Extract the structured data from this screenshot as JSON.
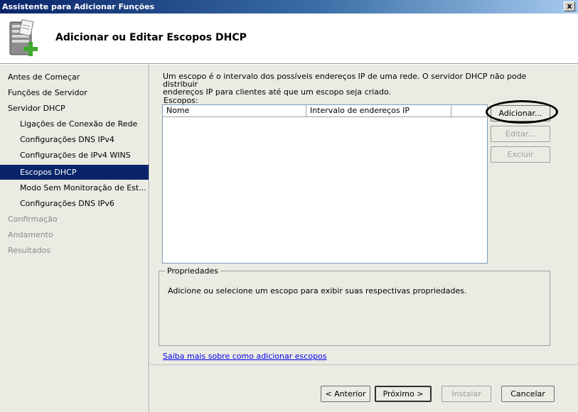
{
  "window": {
    "title": "Assistente para Adicionar Funções",
    "close_label": "x"
  },
  "header": {
    "title": "Adicionar ou Editar Escopos DHCP",
    "icon": "server-add-icon"
  },
  "sidebar": {
    "items": [
      {
        "label": "Antes de Começar",
        "state": "normal",
        "level": 0
      },
      {
        "label": "Funções de Servidor",
        "state": "normal",
        "level": 0
      },
      {
        "label": "Servidor DHCP",
        "state": "normal",
        "level": 0
      },
      {
        "label": "Ligações de Conexão de Rede",
        "state": "normal",
        "level": 1
      },
      {
        "label": "Configurações DNS IPv4",
        "state": "normal",
        "level": 1
      },
      {
        "label": "Configurações de IPv4 WINS",
        "state": "normal",
        "level": 1
      },
      {
        "label": "Escopos DHCP",
        "state": "active",
        "level": 1
      },
      {
        "label": "Modo Sem Monitoração de Est...",
        "state": "normal",
        "level": 1
      },
      {
        "label": "Configurações DNS IPv6",
        "state": "normal",
        "level": 1
      },
      {
        "label": "Confirmação",
        "state": "disabled",
        "level": 0
      },
      {
        "label": "Andamento",
        "state": "disabled",
        "level": 0
      },
      {
        "label": "Resultados",
        "state": "disabled",
        "level": 0
      }
    ]
  },
  "main": {
    "description_line1": "Um escopo é o intervalo dos possíveis endereços IP de uma rede. O servidor DHCP não pode distribuir",
    "description_line2": "endereços IP para clientes até que um escopo seja criado.",
    "scopes_label": "Escopos:",
    "columns": [
      "Nome",
      "Intervalo de endereços IP",
      ""
    ],
    "rows": [],
    "buttons": {
      "add": "Adicionar...",
      "edit": "Editar...",
      "delete": "Excluir"
    },
    "properties": {
      "legend": "Propriedades",
      "text": "Adicione ou selecione um escopo para exibir suas respectivas propriedades."
    },
    "learn_more_link": "Saiba mais sobre como adicionar escopos"
  },
  "footer": {
    "back": "< Anterior",
    "next": "Próximo >",
    "install": "Instalar",
    "cancel": "Cancelar"
  },
  "colors": {
    "title_bar": "#0a246a",
    "active_nav": "#0a246a",
    "link": "#0000ee",
    "panel_bg": "#ebebe3"
  }
}
